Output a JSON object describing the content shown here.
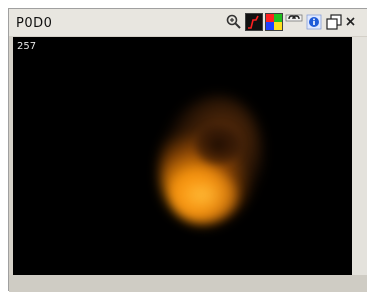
{
  "window": {
    "title": "P0D0"
  },
  "toolbar": {
    "icons": [
      "zoom-in-icon",
      "histogram-icon",
      "color-palette-icon",
      "link-icon",
      "info-icon",
      "copy-icon",
      "close-icon"
    ]
  },
  "viewport": {
    "frame_number": "257"
  },
  "colors": {
    "window_bg": "#d4d0c8",
    "viewport_bg": "#000000",
    "blob_color": "#ff9a10"
  }
}
